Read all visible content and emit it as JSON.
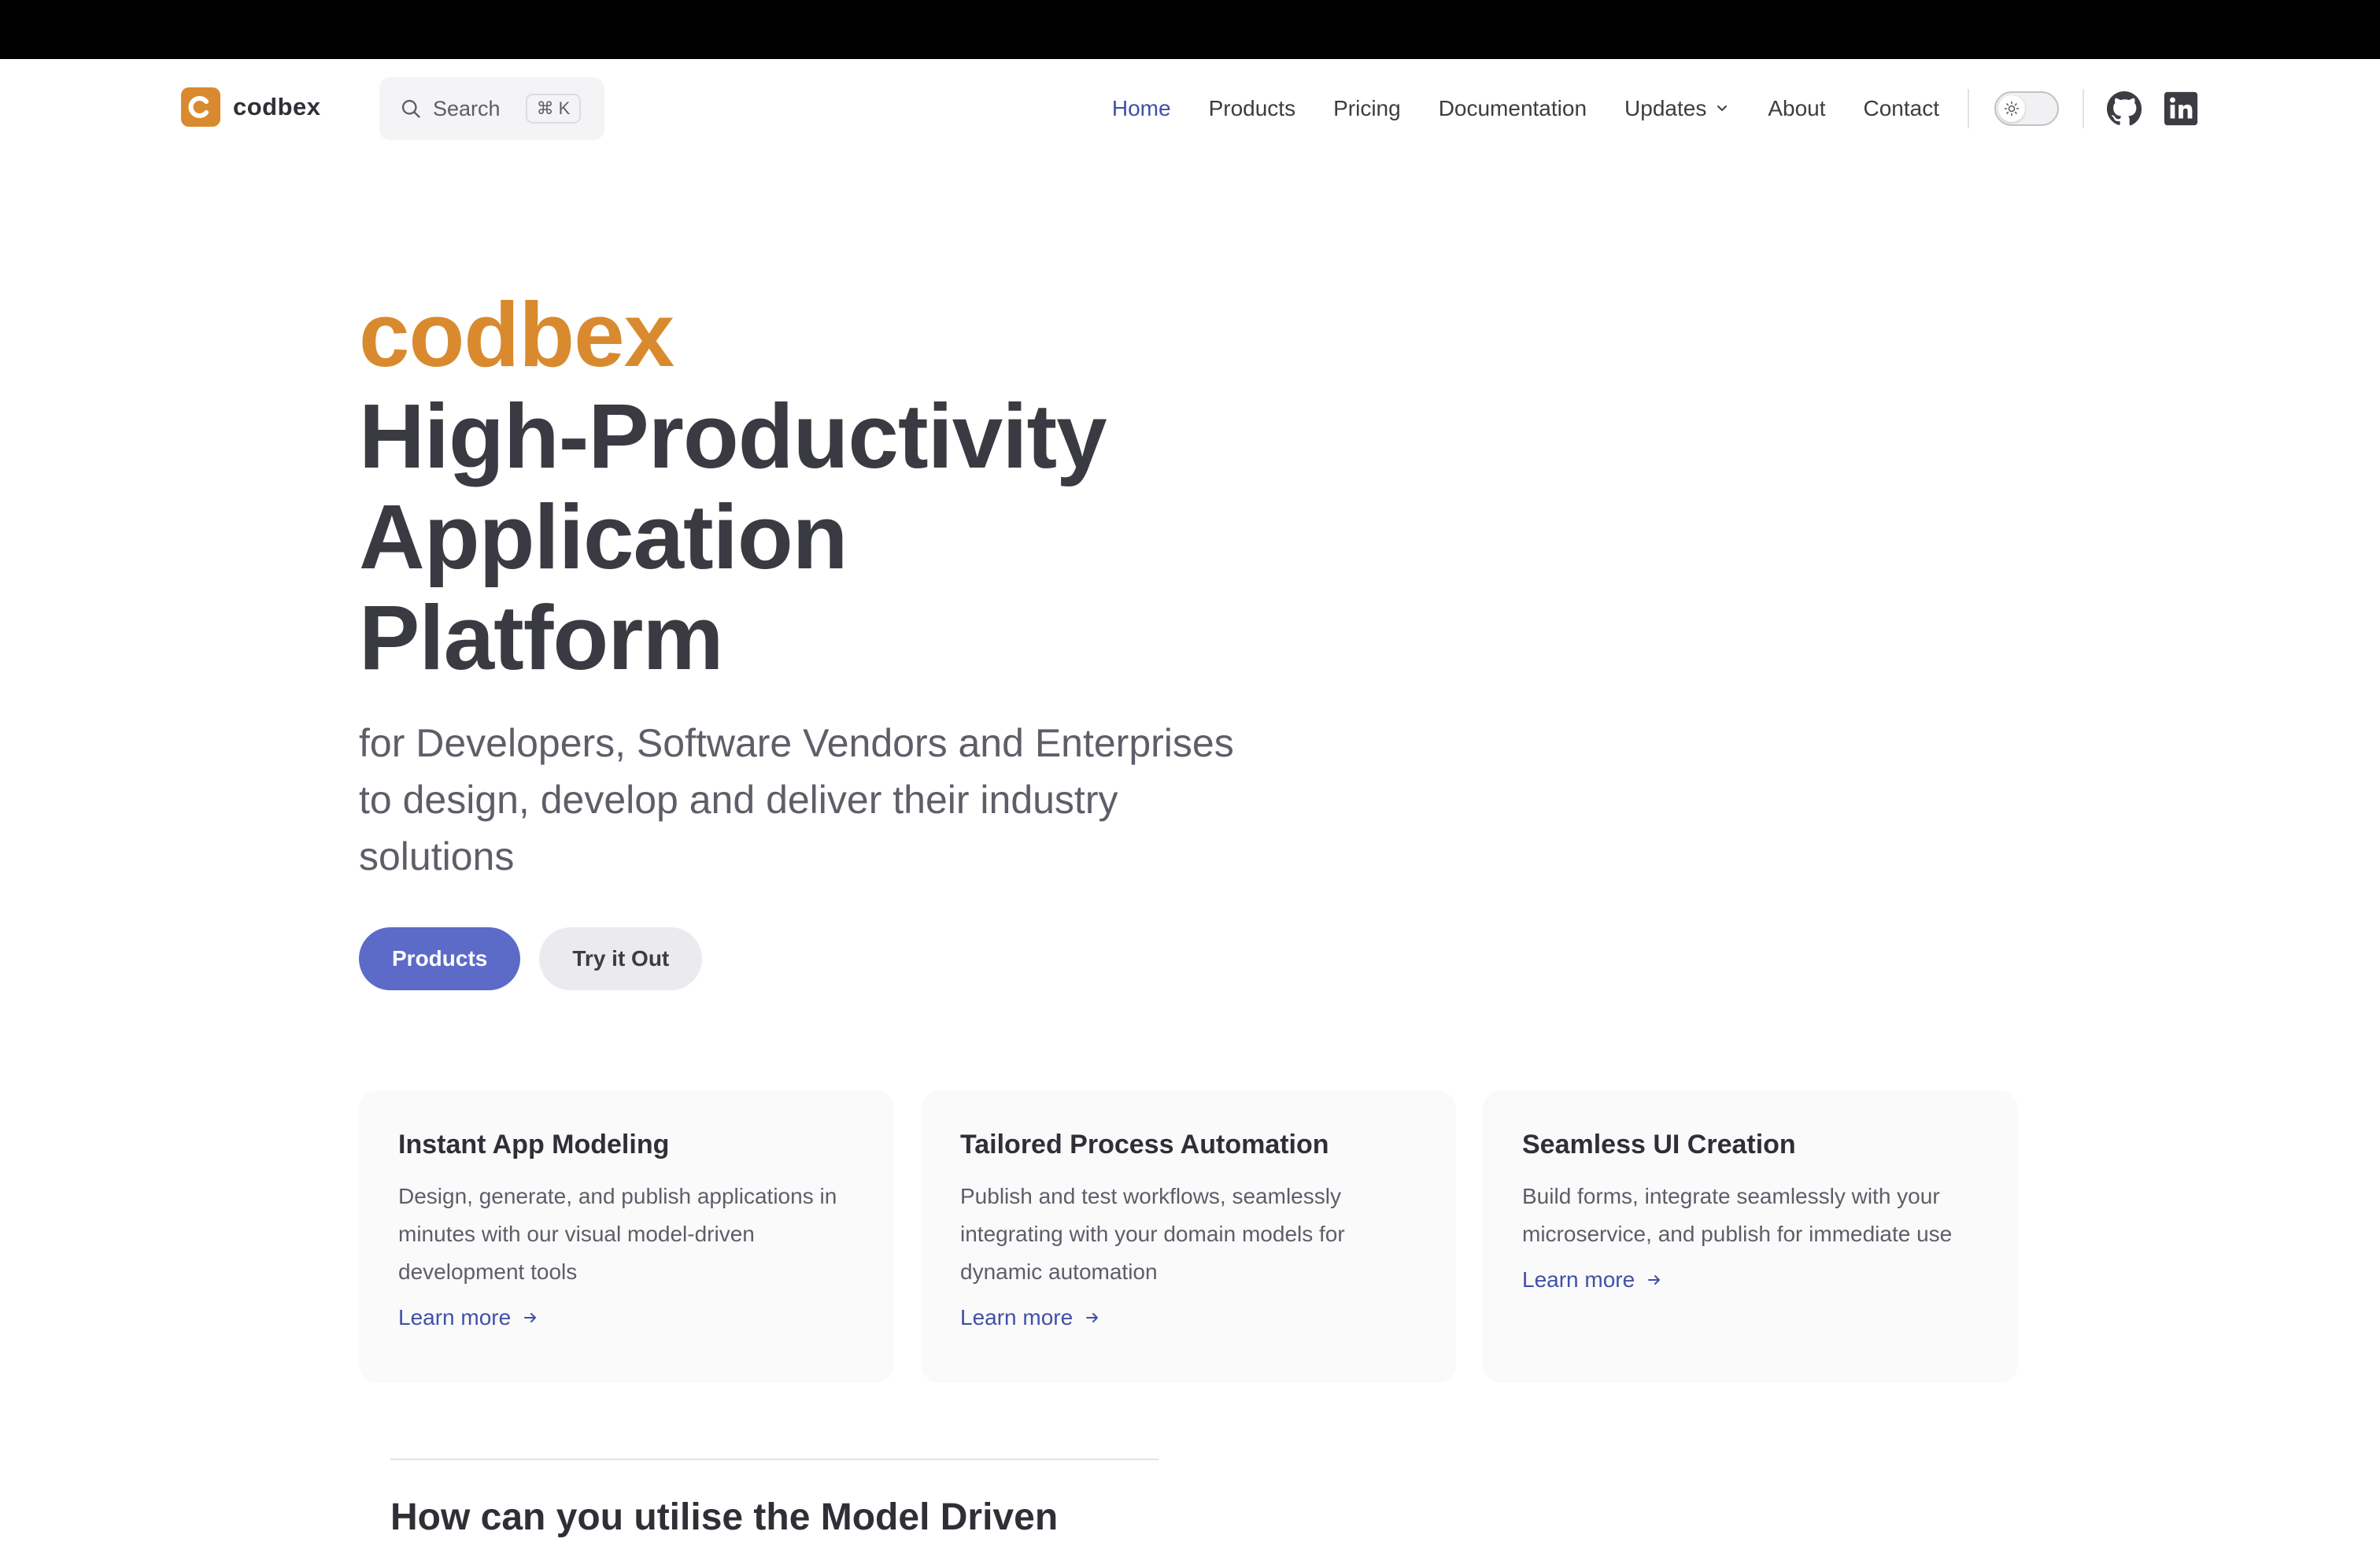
{
  "nav": {
    "logo_text": "codbex",
    "search_label": "Search",
    "search_shortcut": "⌘ K",
    "items": [
      {
        "label": "Home",
        "active": true
      },
      {
        "label": "Products"
      },
      {
        "label": "Pricing"
      },
      {
        "label": "Documentation"
      },
      {
        "label": "Updates",
        "has_dropdown": true
      },
      {
        "label": "About"
      },
      {
        "label": "Contact"
      }
    ],
    "icons": [
      "sun-icon",
      "github-icon",
      "linkedin-icon"
    ]
  },
  "hero": {
    "brand": "codbex",
    "headline_lines": [
      "High-Productivity",
      "Application",
      "Platform"
    ],
    "tagline": "for Developers, Software Vendors and Enterprises to design, develop and deliver their industry solutions",
    "primary_button": "Products",
    "secondary_button": "Try it Out"
  },
  "features": [
    {
      "title": "Instant App Modeling",
      "body": "Design, generate, and publish applications in minutes with our visual model-driven development tools",
      "link": "Learn more"
    },
    {
      "title": "Tailored Process Automation",
      "body": "Publish and test workflows, seamlessly integrating with your domain models for dynamic automation",
      "link": "Learn more"
    },
    {
      "title": "Seamless UI Creation",
      "body": "Build forms, integrate seamlessly with your microservice, and publish for immediate use",
      "link": "Learn more"
    }
  ],
  "section": {
    "title": "How can you utilise the Model Driven"
  },
  "colors": {
    "brand": "#d98a2e",
    "accent": "#4050a8",
    "primary_button": "#5c6bc8"
  }
}
